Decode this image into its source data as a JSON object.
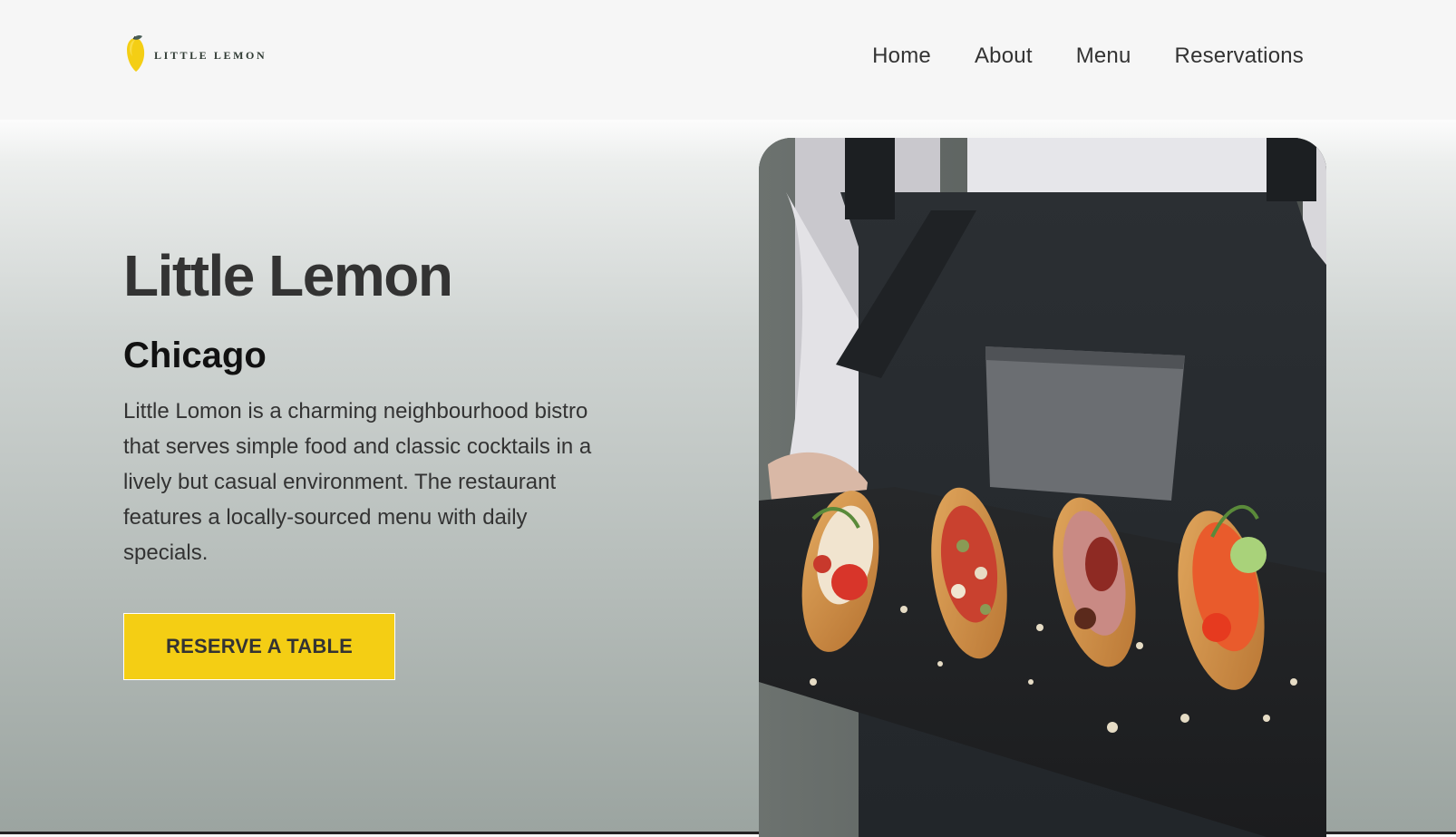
{
  "brand": {
    "logo_icon": "lemon-icon",
    "logo_text": "LITTLE LEMON",
    "colors": {
      "lemon": "#f4ce14",
      "leaf": "#495e57",
      "text": "#333333"
    }
  },
  "nav": {
    "items": [
      {
        "label": "Home"
      },
      {
        "label": "About"
      },
      {
        "label": "Menu"
      },
      {
        "label": "Reservations"
      }
    ]
  },
  "hero": {
    "title": "Little Lemon",
    "subtitle": "Chicago",
    "description": "Little Lomon is a charming neighbourhood bistro that serves simple food and classic cocktails in a lively but casual environment. The restaurant features a locally-sourced menu with daily specials.",
    "cta_label": "RESERVE A TABLE",
    "cta_color": "#f4ce14",
    "image_subject": "chef-holding-bruschetta-platter-image"
  }
}
